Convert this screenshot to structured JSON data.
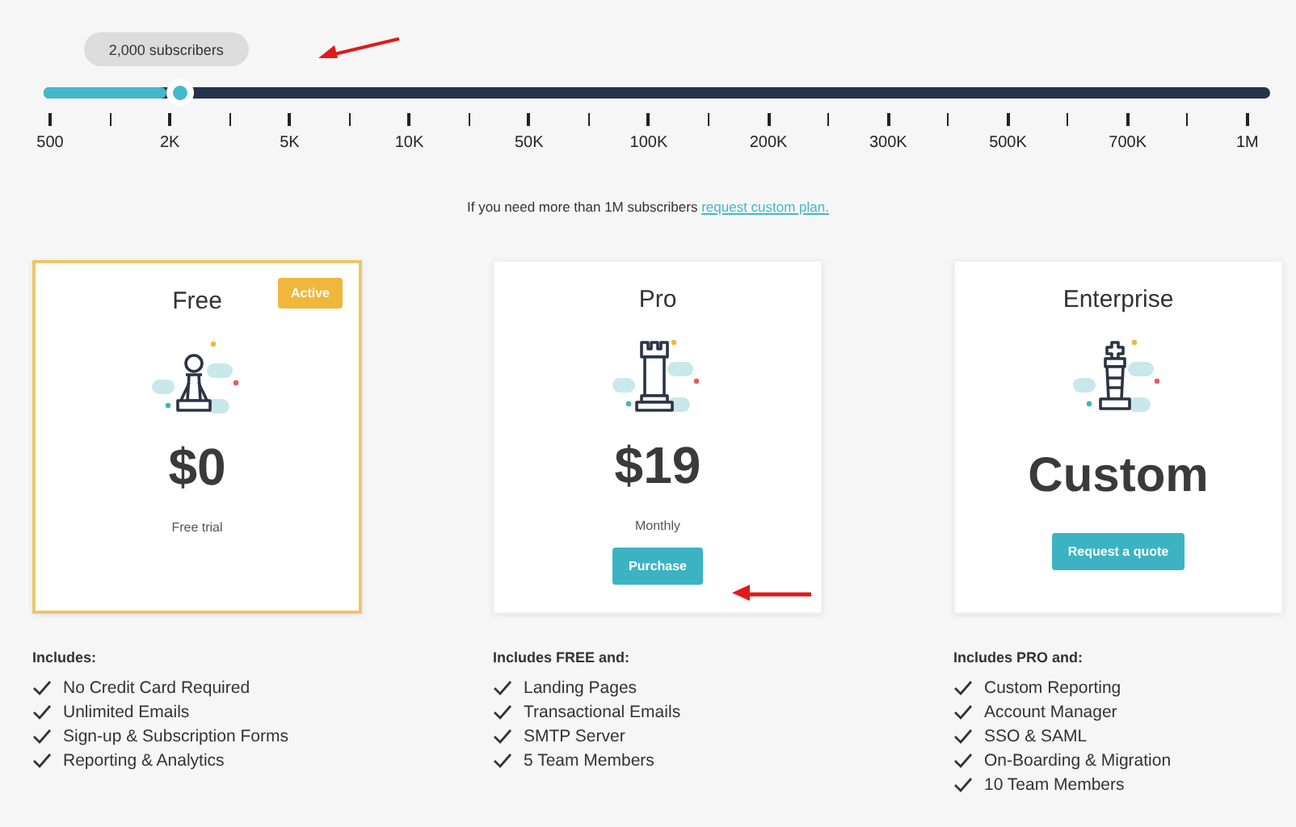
{
  "slider": {
    "tooltip": "2,000 subscribers",
    "level": 0.1,
    "tick_labels": [
      "500",
      "2K",
      "5K",
      "10K",
      "50K",
      "100K",
      "200K",
      "300K",
      "500K",
      "700K",
      "1M"
    ]
  },
  "custom_note": {
    "text": "If you need more than 1M subscribers",
    "link": "request custom plan."
  },
  "plans": [
    {
      "name": "Free",
      "active": true,
      "badge": "Active",
      "kind": "pawn",
      "price": "$0",
      "note": "Free trial",
      "includes": "Includes:",
      "features": [
        "No Credit Card Required",
        "Unlimited Emails",
        "Sign-up & Subscription Forms",
        "Reporting & Analytics"
      ]
    },
    {
      "name": "Pro",
      "active": false,
      "kind": "rook",
      "price": "$19",
      "note": "Monthly",
      "button": "Purchase",
      "includes": "Includes FREE and:",
      "features": [
        "Landing Pages",
        "Transactional Emails",
        "SMTP Server",
        "5 Team Members"
      ]
    },
    {
      "name": "Enterprise",
      "active": false,
      "kind": "king",
      "price": "Custom",
      "button": "Request a quote",
      "includes": "Includes PRO and:",
      "features": [
        "Custom Reporting",
        "Account Manager",
        "SSO & SAML",
        "On-Boarding & Migration",
        "10 Team Members"
      ]
    }
  ]
}
